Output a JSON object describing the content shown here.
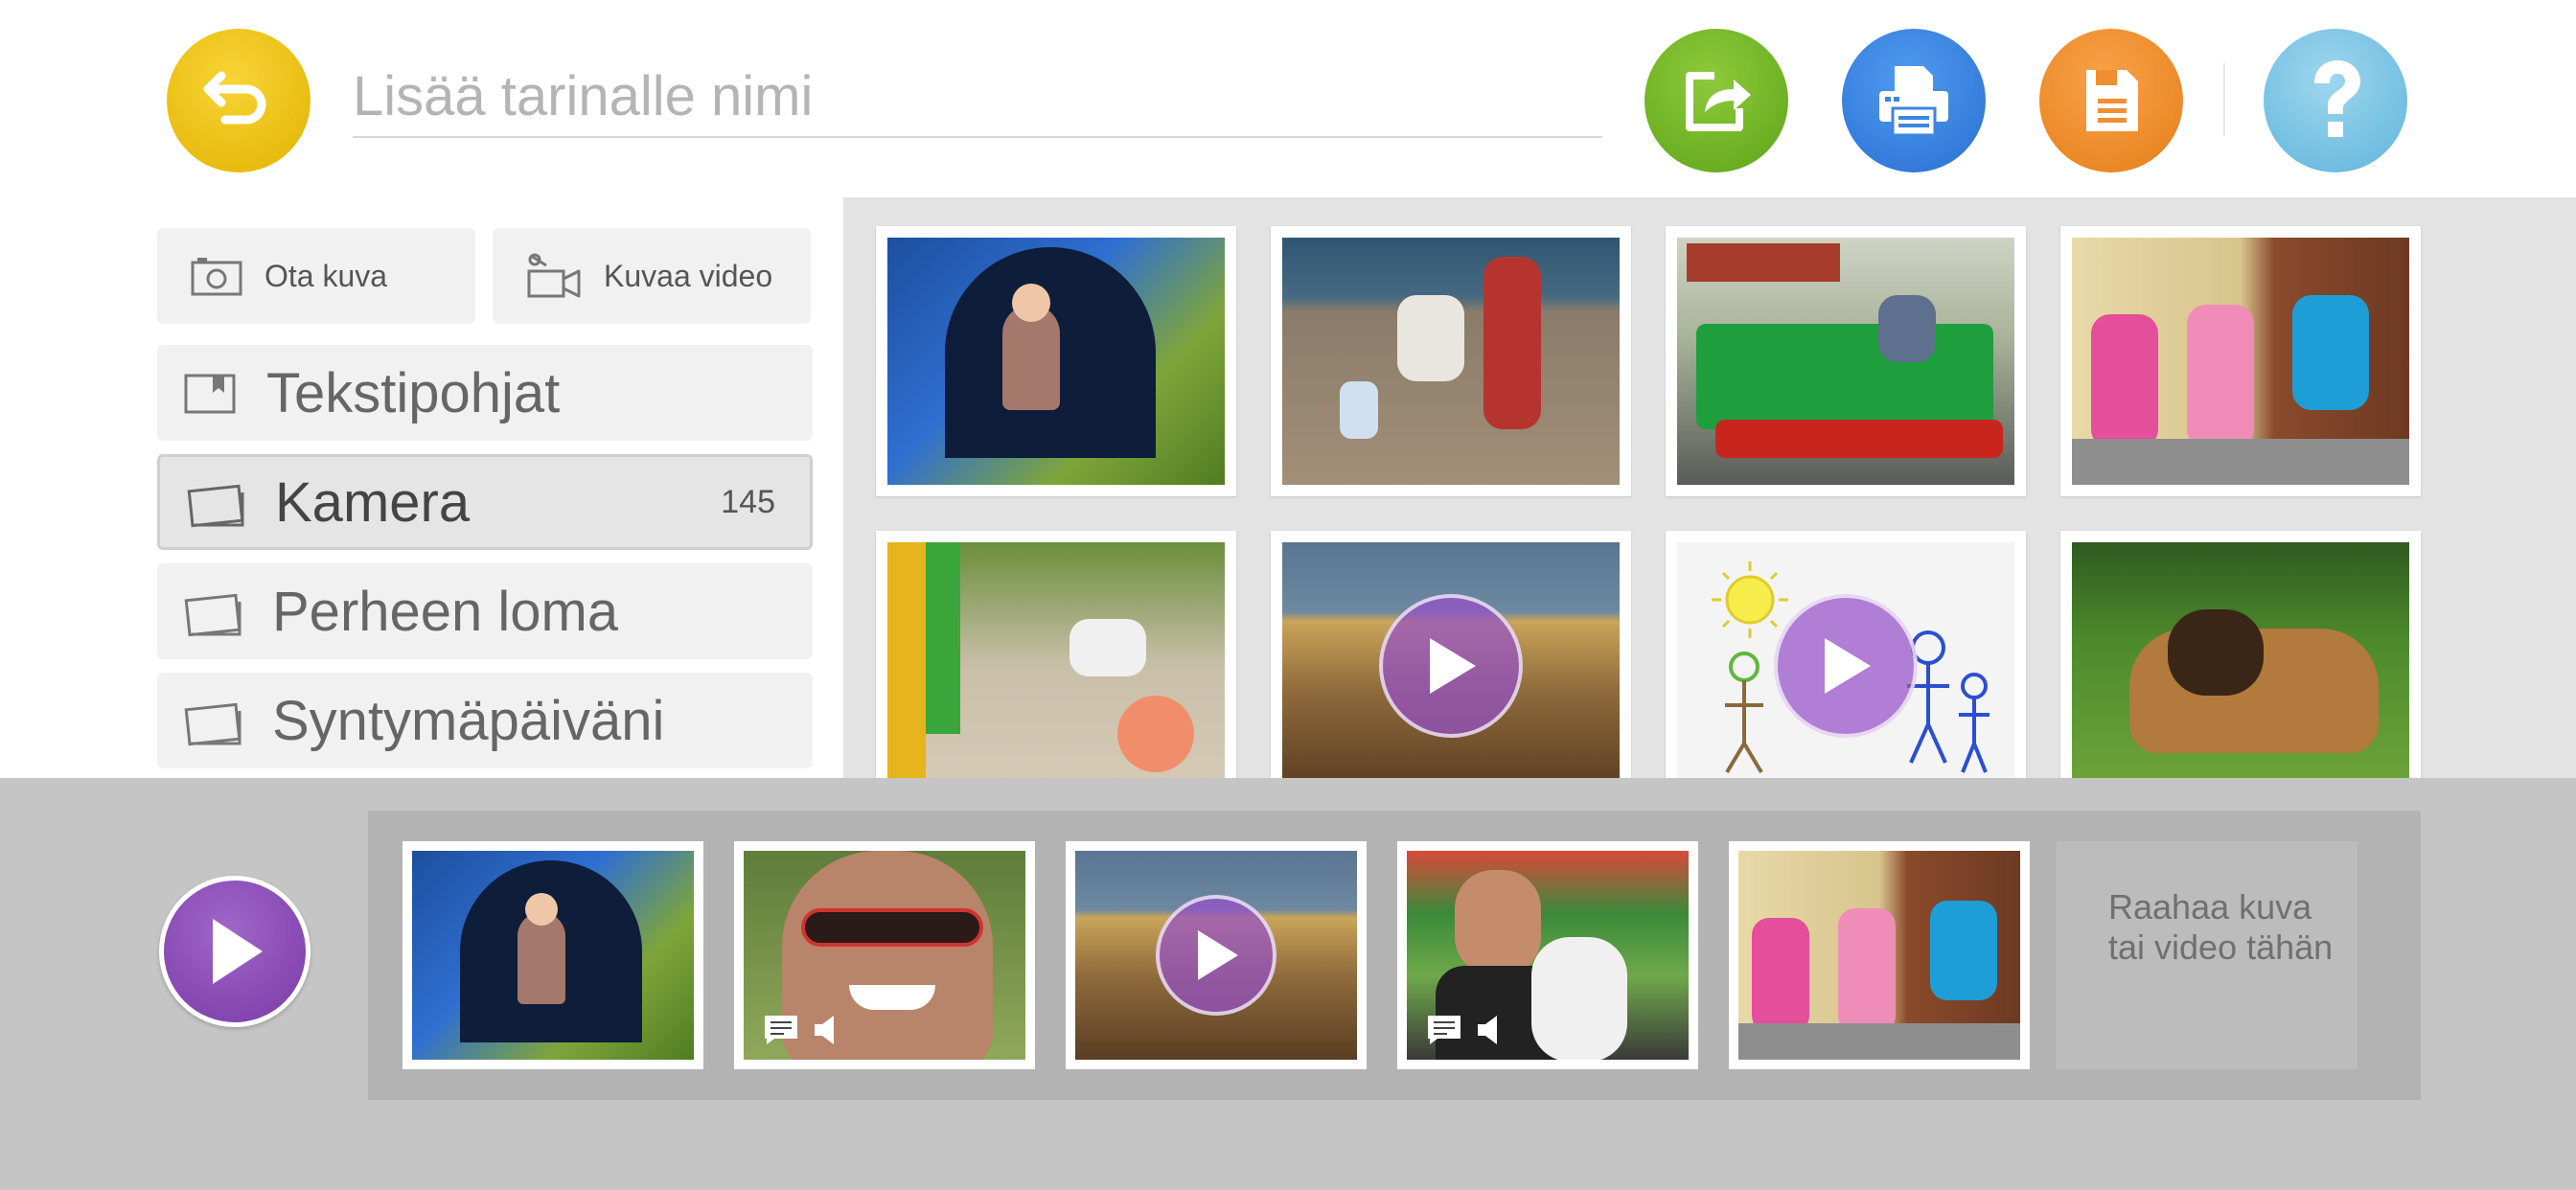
{
  "header": {
    "title_placeholder": "Lisää tarinalle nimi",
    "title_value": ""
  },
  "sidebar": {
    "photo_label": "Ota kuva",
    "video_label": "Kuvaa video",
    "items": [
      {
        "label": "Tekstipohjat",
        "count": ""
      },
      {
        "label": "Kamera",
        "count": "145"
      },
      {
        "label": "Perheen loma",
        "count": ""
      },
      {
        "label": "Syntymäpäiväni",
        "count": ""
      }
    ],
    "active_index": 1
  },
  "timeline": {
    "drop_label": "Raahaa kuva tai video tähän"
  },
  "colors": {
    "back": "#efc41a",
    "share": "#75b82b",
    "print": "#3c85e2",
    "save": "#f08f2f",
    "help": "#7fc7e6",
    "play": "#8c4db8"
  }
}
